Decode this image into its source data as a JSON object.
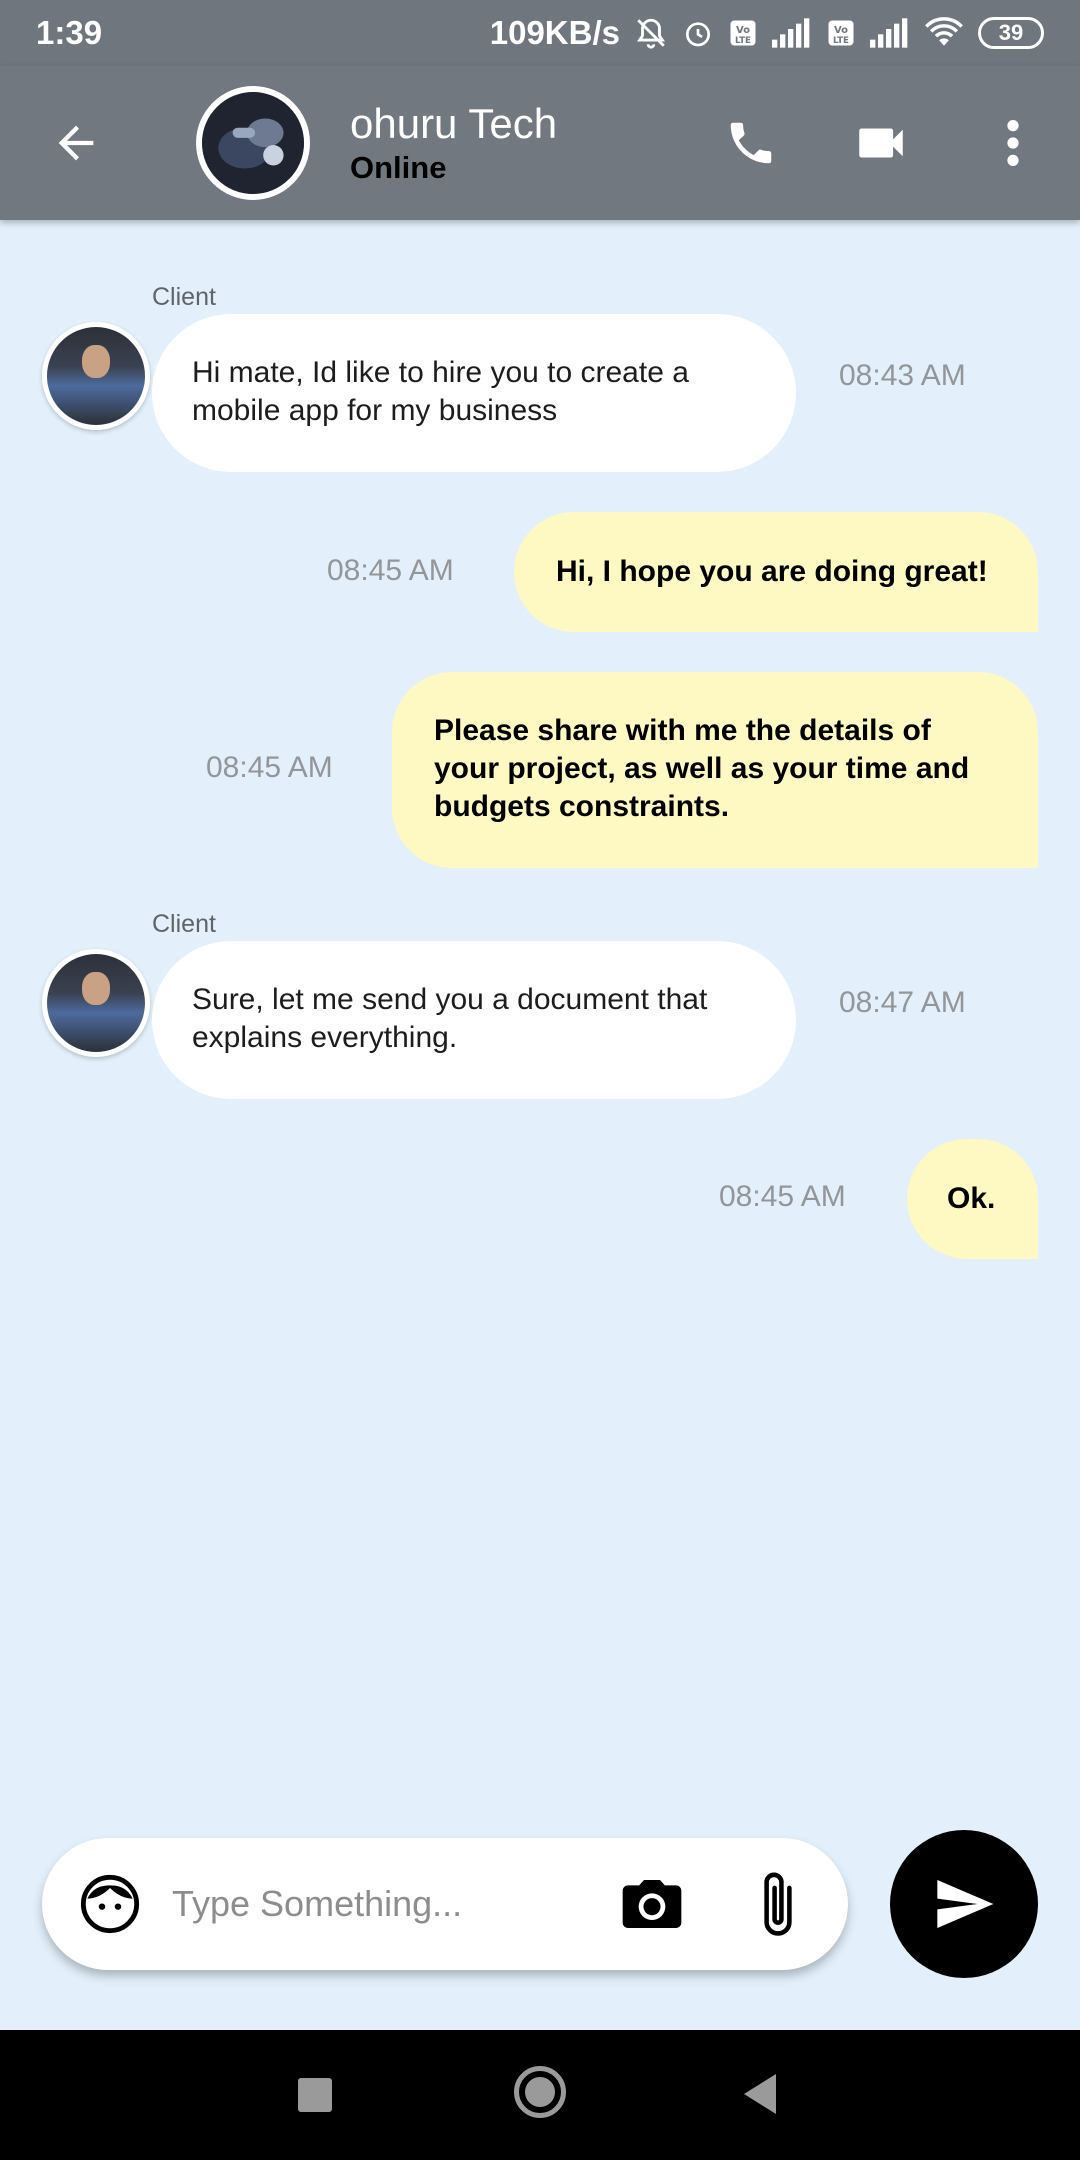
{
  "status_bar": {
    "time": "1:39",
    "net_speed": "109KB/s",
    "battery": "39",
    "icons": [
      "bell-off-icon",
      "alarm-icon",
      "volte-icon",
      "signal-icon",
      "volte-icon",
      "signal-icon",
      "wifi-icon",
      "battery-icon"
    ]
  },
  "header": {
    "contact_name": "ohuru Tech",
    "contact_status": "Online",
    "icons": [
      "back-arrow-icon",
      "phone-icon",
      "video-camera-icon",
      "more-vert-icon"
    ]
  },
  "messages": [
    {
      "direction": "incoming",
      "sender_label": "Client",
      "lines": [
        "Hi mate, Id like to hire you to create a",
        "mobile app for my business"
      ],
      "time": "08:43 AM"
    },
    {
      "direction": "outgoing",
      "lines": [
        "Hi, I hope you are doing great!"
      ],
      "time": "08:45 AM"
    },
    {
      "direction": "outgoing",
      "lines": [
        "Please share with me the details of",
        "your project, as well as your time and",
        "budgets constraints."
      ],
      "time": "08:45 AM"
    },
    {
      "direction": "incoming",
      "sender_label": "Client",
      "lines": [
        "Sure, let me send you a document that",
        "explains everything."
      ],
      "time": "08:47 AM"
    },
    {
      "direction": "outgoing",
      "lines": [
        "Ok."
      ],
      "time": "08:45 AM"
    }
  ],
  "composer": {
    "placeholder": "Type Something...",
    "value": "",
    "icons": [
      "emoji-face-icon",
      "camera-icon",
      "attach-icon",
      "send-icon"
    ]
  },
  "colors": {
    "background": "#e3f0fb",
    "app_bar": "#72787f",
    "incoming_bubble": "#ffffff",
    "outgoing_bubble": "#fef8c2",
    "send_button": "#000000"
  }
}
